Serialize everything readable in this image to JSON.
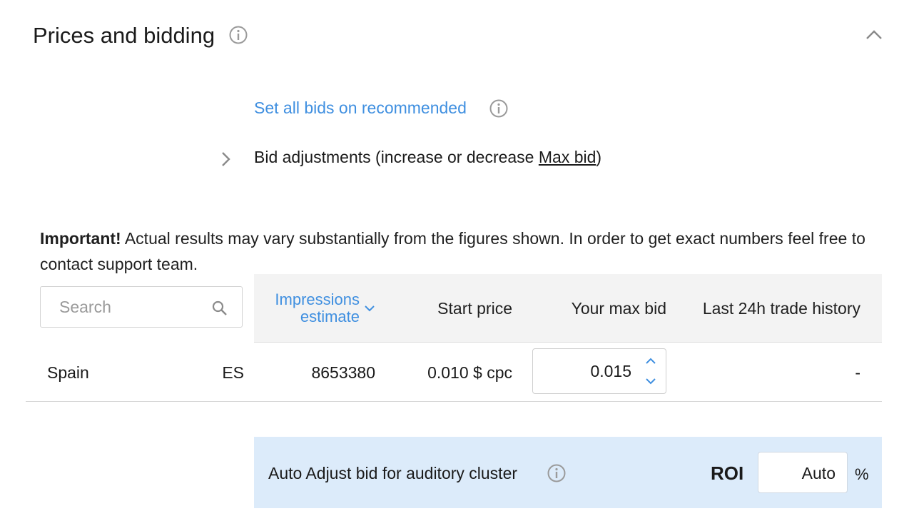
{
  "section": {
    "title": "Prices and bidding"
  },
  "actions": {
    "set_all_bids": "Set all bids on recommended",
    "bid_adjustments_prefix": "Bid adjustments (increase or decrease ",
    "bid_adjustments_link": "Max bid",
    "bid_adjustments_suffix": ")"
  },
  "notice": {
    "bold": "Important!",
    "text": " Actual results may vary substantially from the figures shown. In order to get exact numbers feel free to contact support team."
  },
  "search": {
    "placeholder": "Search",
    "value": ""
  },
  "table": {
    "columns": {
      "impressions_line1": "Impressions",
      "impressions_line2": "estimate",
      "start_price": "Start price",
      "max_bid": "Your max bid",
      "trade_history": "Last 24h trade history"
    },
    "rows": [
      {
        "country": "Spain",
        "code": "ES",
        "impressions": "8653380",
        "start_price": "0.010 $ cpc",
        "max_bid": "0.015",
        "trade_history": "-"
      }
    ]
  },
  "auto_adjust": {
    "label": "Auto Adjust bid for auditory cluster",
    "roi_label": "ROI",
    "roi_value": "Auto",
    "unit": "%"
  },
  "colors": {
    "accent": "#3f8fe0",
    "panel_bg": "#dcebfa",
    "header_bg": "#f3f3f3"
  }
}
